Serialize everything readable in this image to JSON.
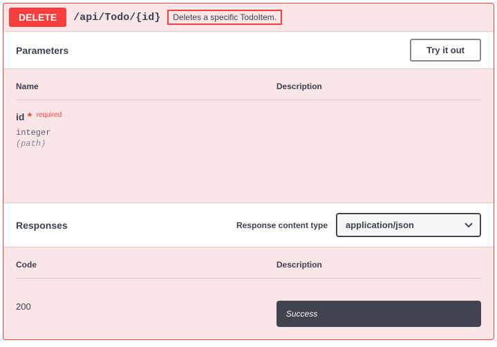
{
  "operation": {
    "method": "DELETE",
    "path": "/api/Todo/{id}",
    "summary": "Deletes a specific TodoItem."
  },
  "parameters": {
    "title": "Parameters",
    "try_label": "Try it out",
    "headers": {
      "name": "Name",
      "description": "Description"
    },
    "items": [
      {
        "name": "id",
        "required_star": "*",
        "required_label": "required",
        "type": "integer",
        "in": "(path)"
      }
    ]
  },
  "responses": {
    "title": "Responses",
    "content_type_label": "Response content type",
    "content_type_value": "application/json",
    "headers": {
      "code": "Code",
      "description": "Description"
    },
    "items": [
      {
        "code": "200",
        "description": "Success"
      }
    ]
  }
}
